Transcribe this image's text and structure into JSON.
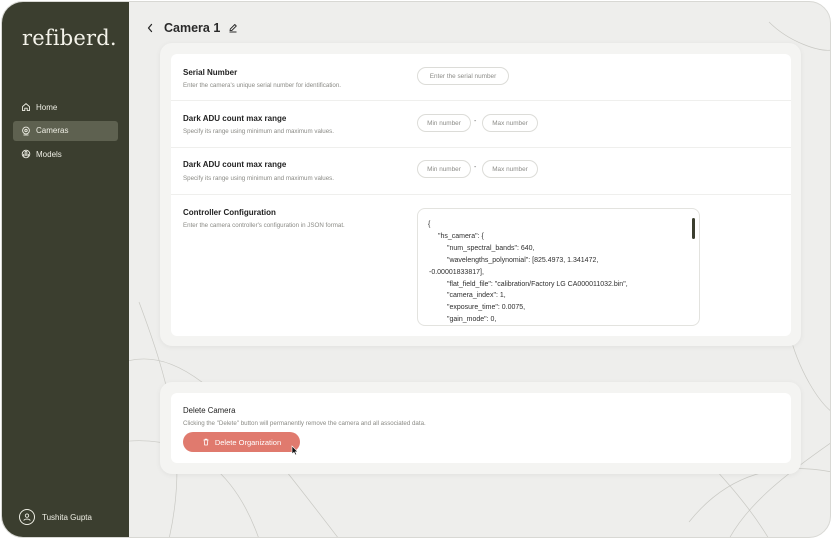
{
  "app": {
    "logo_text": "refiberd."
  },
  "sidebar": {
    "items": [
      {
        "label": "Home",
        "icon": "home-icon",
        "active": false
      },
      {
        "label": "Cameras",
        "icon": "camera-icon",
        "active": true
      },
      {
        "label": "Models",
        "icon": "models-icon",
        "active": false
      }
    ],
    "user_name": "Tushita Gupta"
  },
  "header": {
    "title": "Camera 1"
  },
  "form": {
    "serial": {
      "title": "Serial Number",
      "desc": "Enter the camera's unique serial number for identification.",
      "placeholder": "Enter the serial number"
    },
    "dark_adu_1": {
      "title": "Dark ADU count max range",
      "desc": "Specify its range using minimum and maximum values.",
      "min_placeholder": "Min number",
      "max_placeholder": "Max number",
      "separator": "-"
    },
    "dark_adu_2": {
      "title": "Dark ADU count max range",
      "desc": "Specify its range using minimum and maximum values.",
      "min_placeholder": "Min number",
      "max_placeholder": "Max number",
      "separator": "-"
    },
    "controller": {
      "title": "Controller Configuration",
      "desc": "Enter the camera controller's configuration in JSON format.",
      "json_lines": [
        "{",
        "\"hs_camera\": {",
        "\"num_spectral_bands\": 640,",
        "\"wavelengths_polynomial\": [825.4973, 1.341472,",
        "-0.00001833817],",
        "\"flat_field_file\": \"calibration/Factory LG CA000011032.bin\",",
        "\"camera_index\": 1,",
        "\"exposure_time\": 0.0075,",
        "\"gain_mode\": 0,"
      ]
    }
  },
  "danger": {
    "title": "Delete Camera",
    "desc": "Clicking the \"Delete\" button will permanently remove the camera and all associated data.",
    "button_label": "Delete Organization"
  },
  "colors": {
    "sidebar_bg": "#3b3e2f",
    "sidebar_active": "#5e6150",
    "danger": "#e07a6e",
    "page_bg": "#eeeeec"
  }
}
